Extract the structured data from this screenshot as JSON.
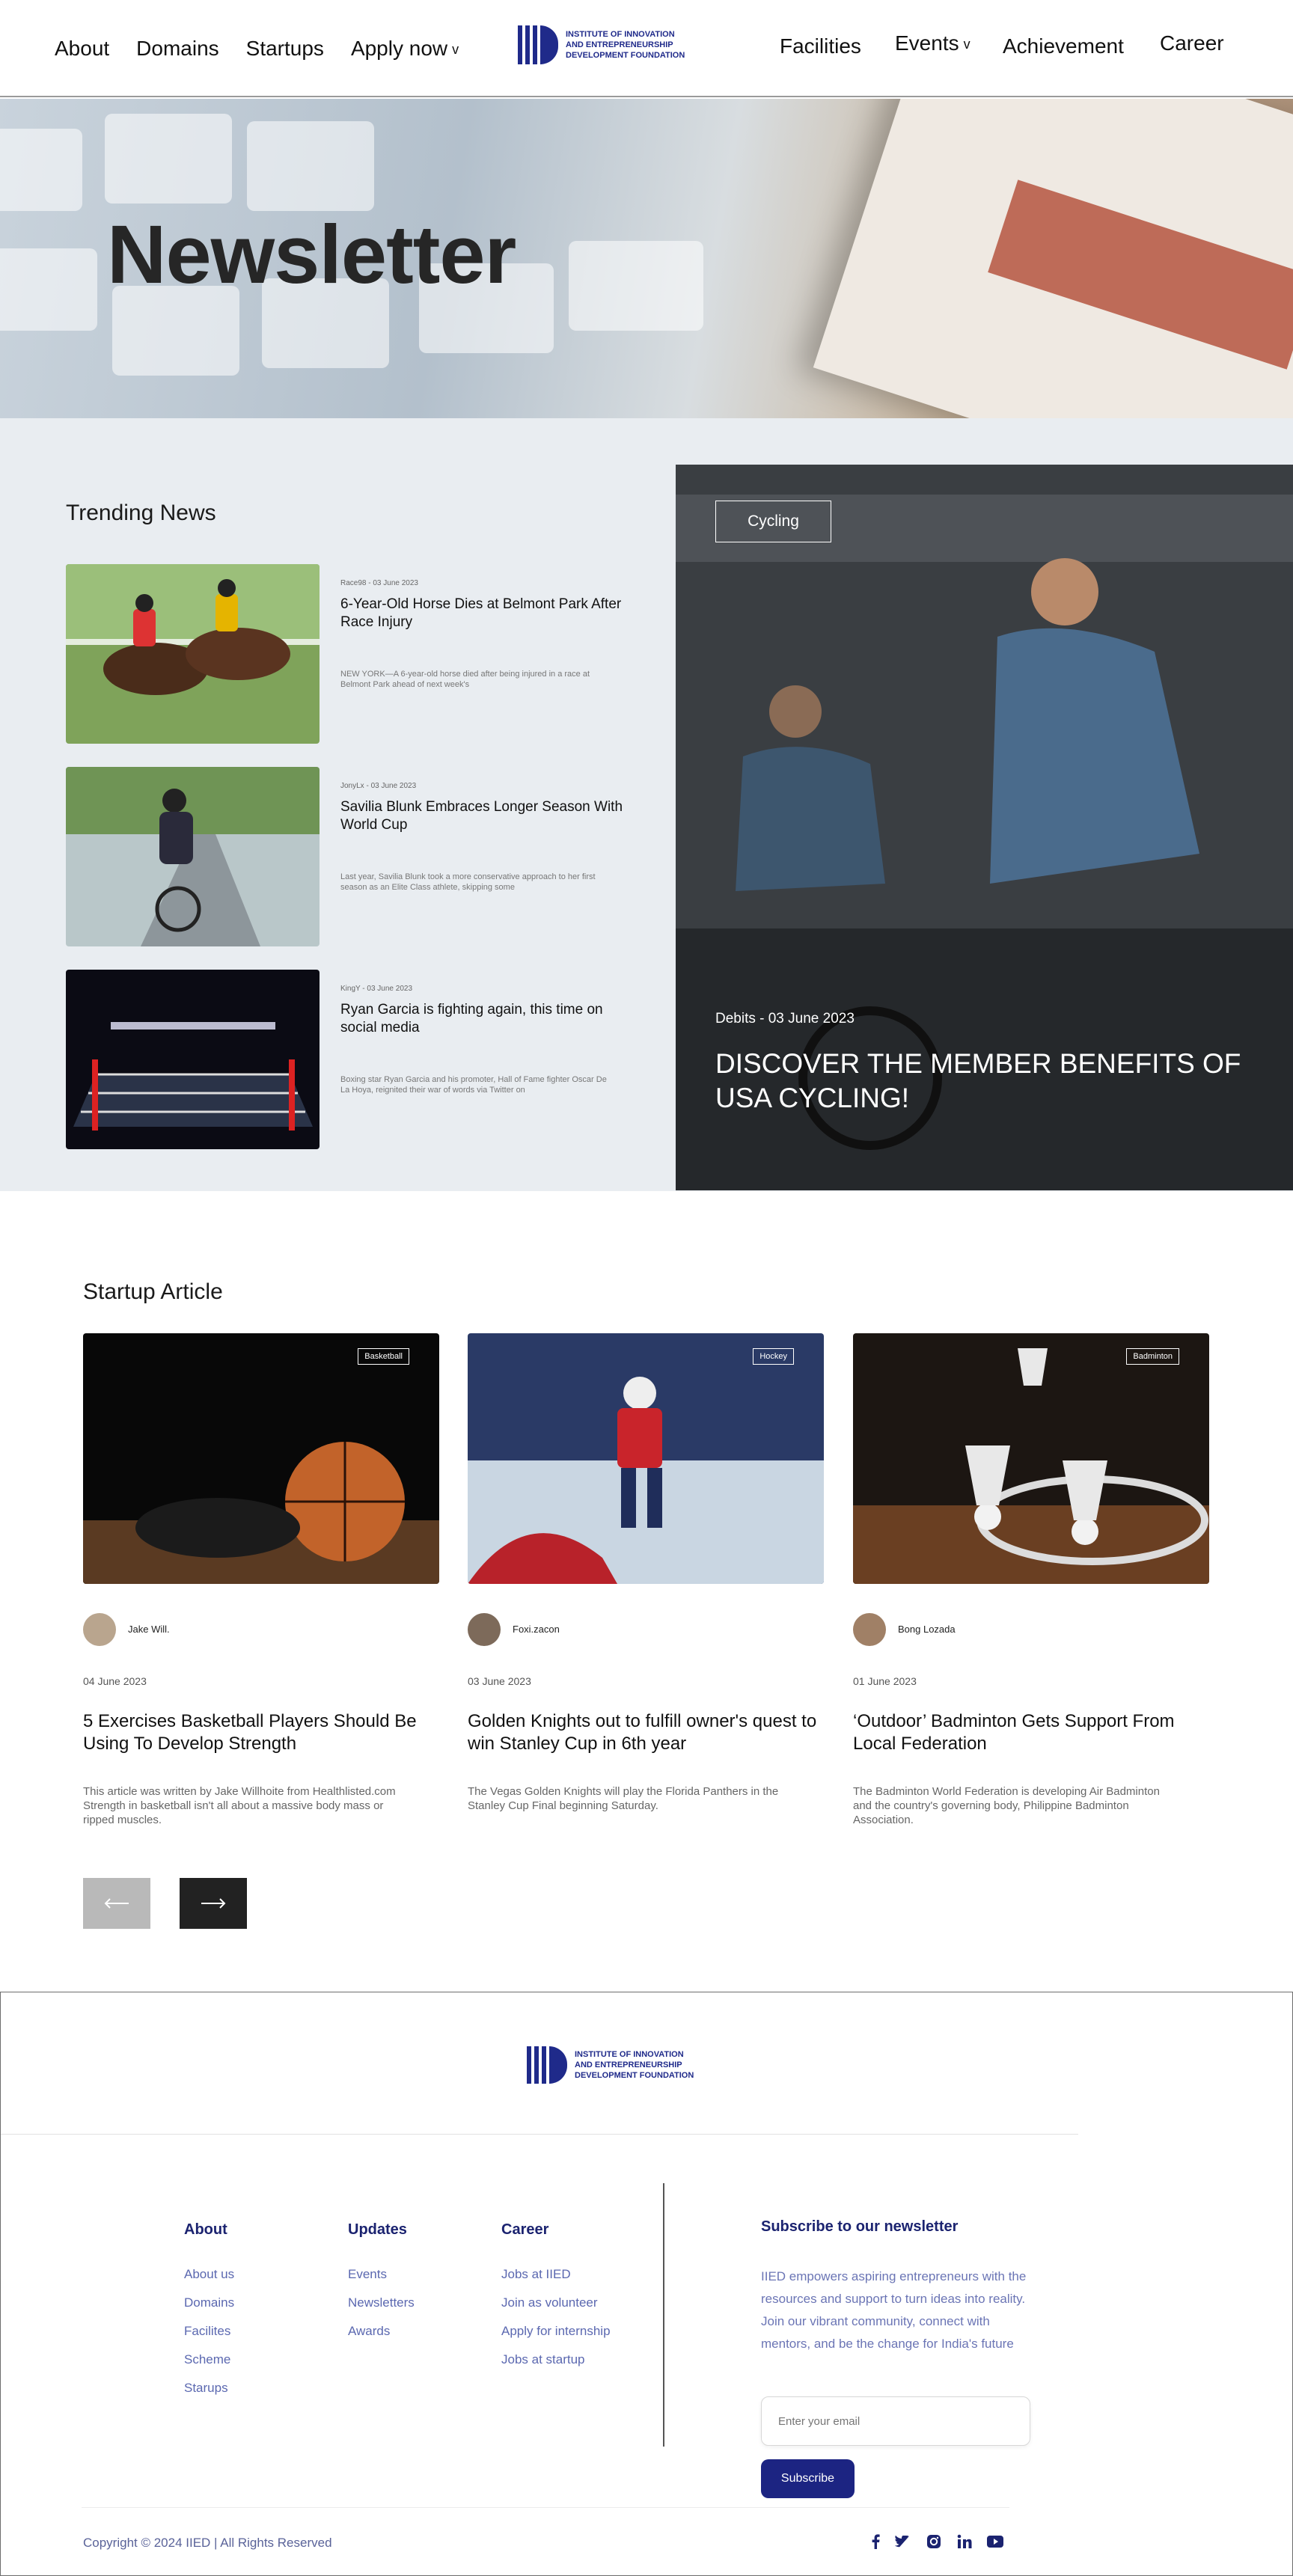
{
  "header": {
    "nav_left": [
      "About",
      "Domains",
      "Startups",
      "Apply now"
    ],
    "nav_right": [
      "Facilities",
      "Events",
      "Achievement",
      "Career"
    ],
    "caret": "v",
    "logo_lines": [
      "INSTITUTE OF INNOVATION",
      "AND ENTREPRENEURSHIP",
      "DEVELOPMENT FOUNDATION"
    ]
  },
  "hero": {
    "title": "Newsletter"
  },
  "trending": {
    "heading": "Trending News",
    "items": [
      {
        "meta": "Race98 - 03 June 2023",
        "title": "6-Year-Old Horse Dies at Belmont Park After Race Injury",
        "desc": "NEW YORK—A 6-year-old horse died after being injured in a race at Belmont Park ahead of next week's",
        "image": "horse-racing-image"
      },
      {
        "meta": "JonyLx - 03 June 2023",
        "title": "Savilia Blunk Embraces Longer Season With World Cup",
        "desc": "Last year, Savilia Blunk took a more conservative approach to her first season as an Elite Class athlete, skipping some",
        "image": "cyclist-image"
      },
      {
        "meta": "KingY - 03 June 2023",
        "title": "Ryan Garcia is fighting again, this time on social media",
        "desc": "Boxing star Ryan Garcia and his promoter, Hall of Fame fighter Oscar De La Hoya, reignited their war of words via Twitter on",
        "image": "boxing-ring-image"
      }
    ],
    "feature": {
      "tag": "Cycling",
      "meta": "Debits - 03 June 2023",
      "title": "DISCOVER THE MEMBER BENEFITS OF USA CYCLING!"
    }
  },
  "startup": {
    "heading": "Startup Article",
    "cards": [
      {
        "tag": "Basketball",
        "author": "Jake Will.",
        "date": "04 June 2023",
        "title": "5 Exercises Basketball Players Should Be Using To Develop Strength",
        "desc": "This article was written by Jake Willhoite from Healthlisted.com Strength in basketball isn't all about a massive body mass or ripped muscles."
      },
      {
        "tag": "Hockey",
        "author": "Foxi.zacon",
        "date": "03 June 2023",
        "title": "Golden Knights out to fulfill owner's quest to win Stanley Cup in 6th year",
        "desc": "The Vegas Golden Knights will play the Florida Panthers in the Stanley Cup Final beginning Saturday."
      },
      {
        "tag": "Badminton",
        "author": "Bong Lozada",
        "date": "01 June 2023",
        "title": "‘Outdoor’ Badminton Gets Support From Local Federation",
        "desc": "The Badminton World Federation is developing Air Badminton and the country's governing body, Philippine Badminton Association."
      }
    ],
    "prev_icon": "arrow-left-icon",
    "next_icon": "arrow-right-icon"
  },
  "footer": {
    "columns": [
      {
        "title": "About",
        "links": [
          "About us",
          "Domains",
          "Facilites",
          "Scheme",
          "Starups"
        ]
      },
      {
        "title": "Updates",
        "links": [
          "Events",
          "Newsletters",
          "Awards"
        ]
      },
      {
        "title": "Career",
        "links": [
          "Jobs at IIED",
          "Join as volunteer",
          "Apply for internship",
          "Jobs at startup"
        ]
      }
    ],
    "subscribe": {
      "title": "Subscribe to our newsletter",
      "desc": "IIED empowers aspiring entrepreneurs with the resources and support to turn ideas into reality. Join our vibrant community, connect with mentors, and be the change for India's future",
      "placeholder": "Enter your email",
      "button": "Subscribe"
    },
    "copyright": "Copyright © 2024 IIED  | All Rights Reserved",
    "social": [
      "facebook-icon",
      "twitter-icon",
      "instagram-icon",
      "linkedin-icon",
      "youtube-icon"
    ]
  },
  "colors": {
    "brand": "#1c2482",
    "link": "#5b68b0",
    "trending_bg": "#e9edf1"
  }
}
